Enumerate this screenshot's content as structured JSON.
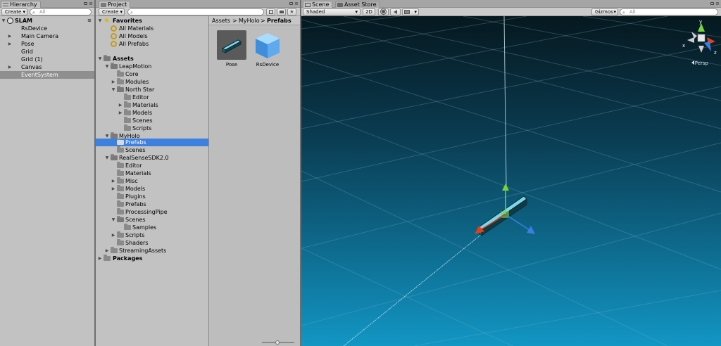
{
  "hierarchy": {
    "tab_label": "Hierarchy",
    "create_label": "Create",
    "search_placeholder": "All",
    "scene_name": "SLAM",
    "items": [
      {
        "label": "RsDevice"
      },
      {
        "label": "Main Camera"
      },
      {
        "label": "Pose"
      },
      {
        "label": "Grid"
      },
      {
        "label": "Grid (1)"
      },
      {
        "label": "Canvas"
      },
      {
        "label": "EventSystem"
      }
    ]
  },
  "project": {
    "tab_label": "Project",
    "create_label": "Create",
    "favorites": {
      "label": "Favorites",
      "items": [
        {
          "label": "All Materials"
        },
        {
          "label": "All Models"
        },
        {
          "label": "All Prefabs"
        }
      ]
    },
    "tree": [
      {
        "label": "Assets"
      },
      {
        "label": "LeapMotion"
      },
      {
        "label": "Core"
      },
      {
        "label": "Modules"
      },
      {
        "label": "North Star"
      },
      {
        "label": "Editor"
      },
      {
        "label": "Materials"
      },
      {
        "label": "Models"
      },
      {
        "label": "Scenes"
      },
      {
        "label": "Scripts"
      },
      {
        "label": "MyHolo"
      },
      {
        "label": "Prefabs"
      },
      {
        "label": "Scenes"
      },
      {
        "label": "RealSenseSDK2.0"
      },
      {
        "label": "Editor"
      },
      {
        "label": "Materials"
      },
      {
        "label": "Misc"
      },
      {
        "label": "Models"
      },
      {
        "label": "Plugins"
      },
      {
        "label": "Prefabs"
      },
      {
        "label": "ProcessingPipe"
      },
      {
        "label": "Scenes"
      },
      {
        "label": "Samples"
      },
      {
        "label": "Scripts"
      },
      {
        "label": "Shaders"
      },
      {
        "label": "StreamingAssets"
      },
      {
        "label": "Packages"
      }
    ],
    "breadcrumb": [
      "Assets",
      "MyHolo",
      "Prefabs"
    ],
    "breadcrumb_sep": ">",
    "assets": [
      {
        "label": "Pose"
      },
      {
        "label": "RsDevice"
      }
    ]
  },
  "scene": {
    "tab_label": "Scene",
    "asset_store_label": "Asset Store",
    "shading_label": "Shaded",
    "mode_2d_label": "2D",
    "gizmos_label": "Gizmos",
    "search_placeholder": "All",
    "persp_label": "Persp",
    "axis_x": "x",
    "axis_y": "y",
    "axis_z": "z",
    "colors": {
      "x_axis": "#e0401c",
      "y_axis": "#7ad33a",
      "z_axis": "#3a7fe0",
      "selection": "#3d80df"
    }
  },
  "icons": {
    "search": "⌕",
    "lock": "🔒",
    "menu": "≡",
    "dropdown": "▾",
    "expanded": "▼",
    "collapsed": "▶",
    "star": "★"
  }
}
